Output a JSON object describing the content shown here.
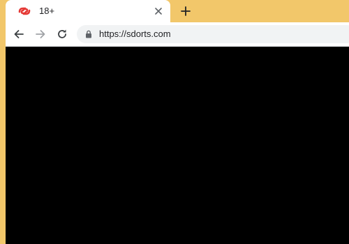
{
  "tab": {
    "title": "18+",
    "favicon_icon": "red-link-logo-icon",
    "close_icon": "close-icon"
  },
  "new_tab_icon": "plus-icon",
  "toolbar": {
    "back_icon": "arrow-left-icon",
    "forward_icon": "arrow-right-icon",
    "reload_icon": "reload-icon",
    "lock_icon": "lock-icon",
    "url": "https://sdorts.com"
  },
  "colors": {
    "frame": "#f2c76a",
    "viewport": "#000000",
    "favicon": "#e53935"
  }
}
